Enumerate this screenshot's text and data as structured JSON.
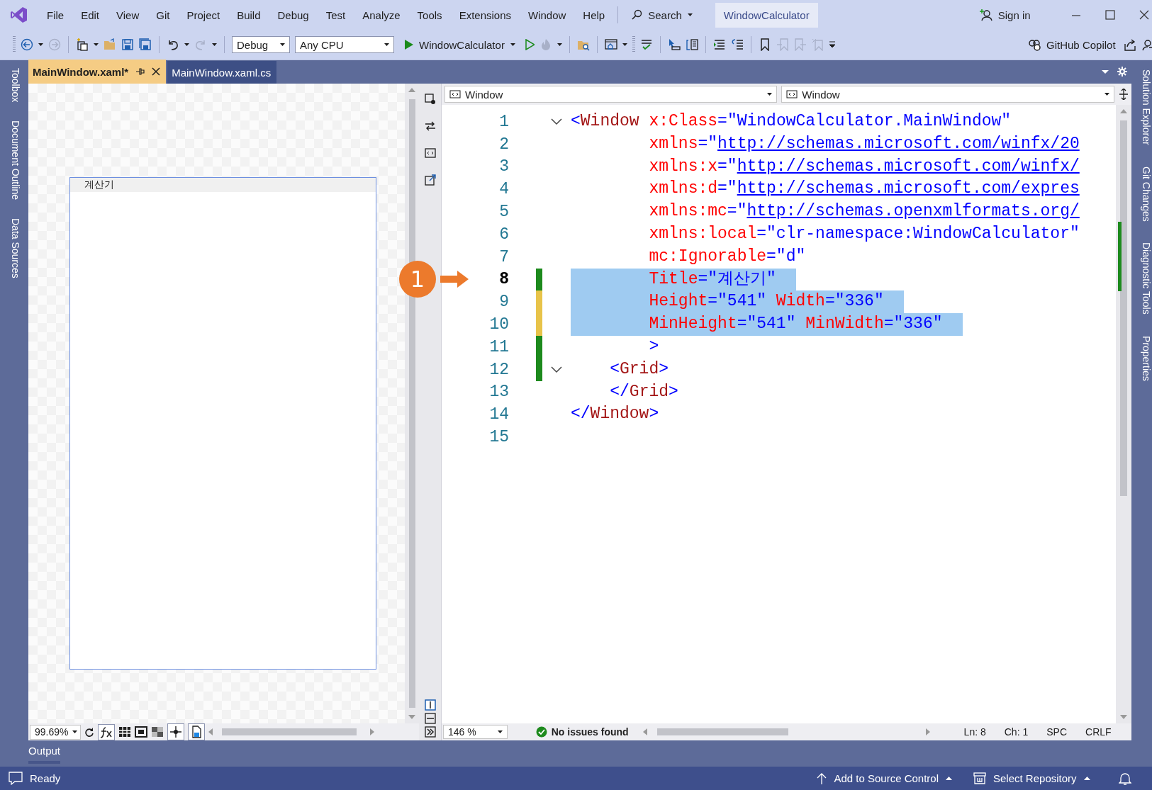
{
  "title_bar": {
    "menu": [
      "File",
      "Edit",
      "View",
      "Git",
      "Project",
      "Build",
      "Debug",
      "Test",
      "Analyze",
      "Tools",
      "Extensions",
      "Window",
      "Help"
    ],
    "search": "Search",
    "solution_name": "WindowCalculator",
    "sign_in": "Sign in"
  },
  "toolbar": {
    "configuration": "Debug",
    "platform": "Any CPU",
    "start_target": "WindowCalculator",
    "copilot": "GitHub Copilot"
  },
  "left_tabs": [
    "Toolbox",
    "Document Outline",
    "Data Sources"
  ],
  "right_tabs": [
    "Solution Explorer",
    "Git Changes",
    "Diagnostic Tools",
    "Properties"
  ],
  "document_tabs": [
    {
      "label": "MainWindow.xaml*",
      "selected": true
    },
    {
      "label": "MainWindow.xaml.cs",
      "selected": false
    }
  ],
  "designer": {
    "window_title": "계산기",
    "zoom": "99.69%"
  },
  "editor": {
    "type_dropdown": "Window",
    "member_dropdown": "Window",
    "lines": [
      {
        "number": "1",
        "current": false,
        "highlighted": false,
        "fold": true,
        "tokens": [
          {
            "kind": "punct",
            "text": "<"
          },
          {
            "kind": "tag",
            "text": "Window"
          },
          {
            "kind": "attr",
            "text": " x:Class"
          },
          {
            "kind": "punct",
            "text": "="
          },
          {
            "kind": "value",
            "text": "\"WindowCalculator.MainWindow\""
          }
        ]
      },
      {
        "number": "2",
        "current": false,
        "highlighted": false,
        "fold": false,
        "tokens": [
          {
            "kind": "attr",
            "text": "        xmlns"
          },
          {
            "kind": "punct",
            "text": "=\""
          },
          {
            "kind": "link",
            "text": "http://schemas.microsoft.com/winfx/20"
          }
        ]
      },
      {
        "number": "3",
        "current": false,
        "highlighted": false,
        "fold": false,
        "tokens": [
          {
            "kind": "attr",
            "text": "        xmlns:x"
          },
          {
            "kind": "punct",
            "text": "=\""
          },
          {
            "kind": "link",
            "text": "http://schemas.microsoft.com/winfx/"
          }
        ]
      },
      {
        "number": "4",
        "current": false,
        "highlighted": false,
        "fold": false,
        "tokens": [
          {
            "kind": "attr",
            "text": "        xmlns:d"
          },
          {
            "kind": "punct",
            "text": "=\""
          },
          {
            "kind": "link",
            "text": "http://schemas.microsoft.com/expres"
          }
        ]
      },
      {
        "number": "5",
        "current": false,
        "highlighted": false,
        "fold": false,
        "tokens": [
          {
            "kind": "attr",
            "text": "        xmlns:mc"
          },
          {
            "kind": "punct",
            "text": "=\""
          },
          {
            "kind": "link",
            "text": "http://schemas.openxmlformats.org/"
          }
        ]
      },
      {
        "number": "6",
        "current": false,
        "highlighted": false,
        "fold": false,
        "tokens": [
          {
            "kind": "attr",
            "text": "        xmlns:local"
          },
          {
            "kind": "punct",
            "text": "="
          },
          {
            "kind": "value",
            "text": "\"clr-namespace:WindowCalculator\""
          }
        ]
      },
      {
        "number": "7",
        "current": false,
        "highlighted": false,
        "fold": false,
        "tokens": [
          {
            "kind": "attr",
            "text": "        mc:Ignorable"
          },
          {
            "kind": "punct",
            "text": "="
          },
          {
            "kind": "value",
            "text": "\"d\""
          }
        ]
      },
      {
        "number": "8",
        "current": true,
        "highlighted": true,
        "color": "#1d8a1d",
        "fold": false,
        "tokens": [
          {
            "kind": "attr",
            "text": "        Title"
          },
          {
            "kind": "punct",
            "text": "="
          },
          {
            "kind": "value",
            "text": "\"계산기\""
          }
        ]
      },
      {
        "number": "9",
        "current": false,
        "highlighted": true,
        "color": "#e8c349",
        "fold": false,
        "tokens": [
          {
            "kind": "attr",
            "text": "        Height"
          },
          {
            "kind": "punct",
            "text": "="
          },
          {
            "kind": "value",
            "text": "\"541\""
          },
          {
            "kind": "attr",
            "text": " Width"
          },
          {
            "kind": "punct",
            "text": "="
          },
          {
            "kind": "value",
            "text": "\"336\""
          }
        ]
      },
      {
        "number": "10",
        "current": false,
        "highlighted": true,
        "color": "#e8c349",
        "fold": false,
        "tokens": [
          {
            "kind": "attr",
            "text": "        MinHeight"
          },
          {
            "kind": "punct",
            "text": "="
          },
          {
            "kind": "value",
            "text": "\"541\""
          },
          {
            "kind": "attr",
            "text": " MinWidth"
          },
          {
            "kind": "punct",
            "text": "="
          },
          {
            "kind": "value",
            "text": "\"336\""
          }
        ]
      },
      {
        "number": "11",
        "current": false,
        "highlighted": false,
        "color": "#1d8a1d",
        "fold": false,
        "tokens": [
          {
            "kind": "punct",
            "text": "        >"
          }
        ]
      },
      {
        "number": "12",
        "current": false,
        "highlighted": false,
        "color": "#1d8a1d",
        "fold": true,
        "tokens": [
          {
            "kind": "punct",
            "text": "    <"
          },
          {
            "kind": "tag",
            "text": "Grid"
          },
          {
            "kind": "punct",
            "text": ">"
          }
        ]
      },
      {
        "number": "13",
        "current": false,
        "highlighted": false,
        "fold": false,
        "tokens": [
          {
            "kind": "punct",
            "text": "    </"
          },
          {
            "kind": "tag",
            "text": "Grid"
          },
          {
            "kind": "punct",
            "text": ">"
          }
        ]
      },
      {
        "number": "14",
        "current": false,
        "highlighted": false,
        "fold": false,
        "tokens": [
          {
            "kind": "punct",
            "text": "</"
          },
          {
            "kind": "tag",
            "text": "Window"
          },
          {
            "kind": "punct",
            "text": ">"
          }
        ]
      },
      {
        "number": "15",
        "current": false,
        "highlighted": false,
        "fold": false
      }
    ],
    "zoom": "146 %",
    "issues": "No issues found",
    "line_info": "Ln: 8",
    "column_info": "Ch: 1",
    "indent_mode": "SPC",
    "line_ending": "CRLF"
  },
  "annotation": {
    "label": "1"
  },
  "output_tab": "Output",
  "status_bar": {
    "message": "Ready",
    "source_control": "Add to Source Control",
    "repository": "Select Repository"
  }
}
